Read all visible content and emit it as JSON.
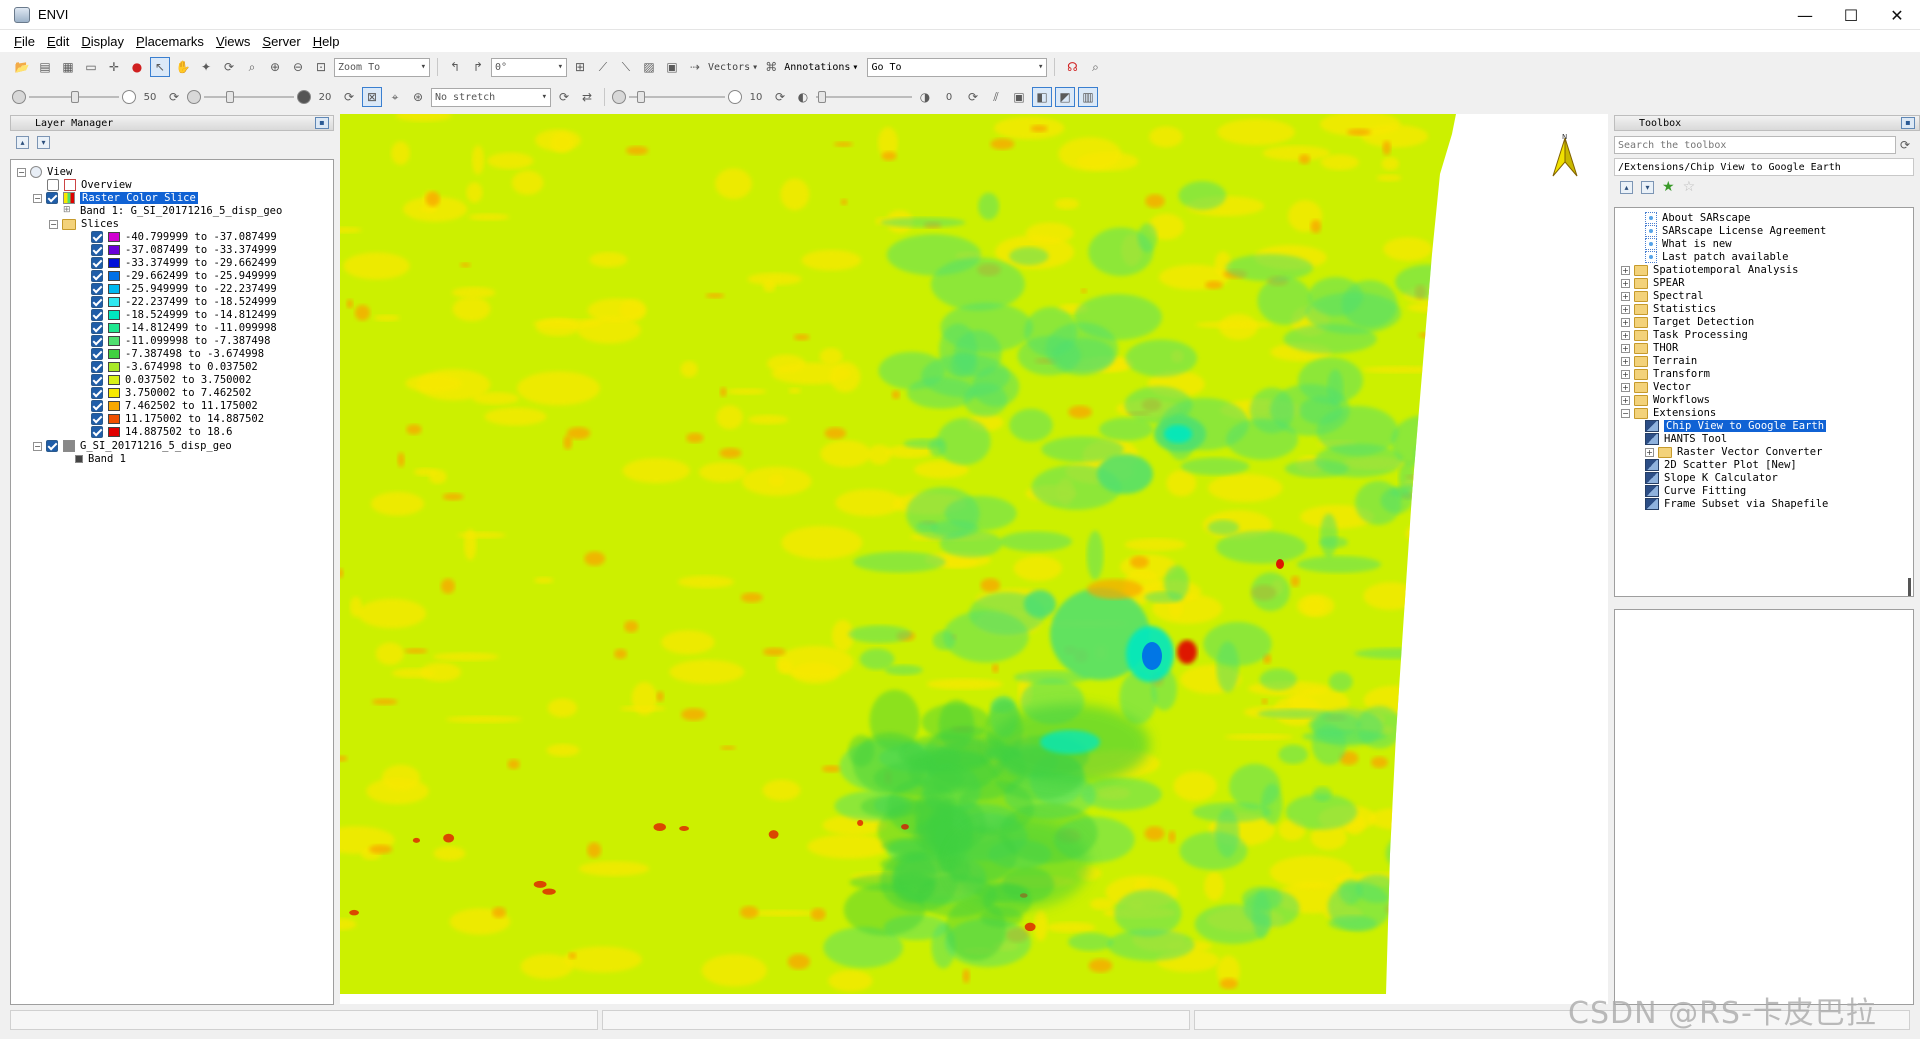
{
  "window": {
    "title": "ENVI",
    "controls": [
      "minimize-icon",
      "maximize-icon",
      "close-icon"
    ]
  },
  "menu": [
    "File",
    "Edit",
    "Display",
    "Placemarks",
    "Views",
    "Server",
    "Help"
  ],
  "toolbar": {
    "zoom_to_placeholder": "Zoom To",
    "rotation_value": "0°",
    "vectors_label": "Vectors",
    "annotations_label": "Annotations",
    "goto_value": "Go To",
    "brightness_value": "50",
    "contrast_value": "20",
    "stretch_value": "No stretch",
    "sharpen_value": "10",
    "transparency_value": "0"
  },
  "layer_manager": {
    "title": "Layer Manager",
    "view_label": "View",
    "overview_label": "Overview",
    "raster_color_slice_label": "Raster Color Slice",
    "band_label": "Band 1: G_SI_20171216_5_disp_geo",
    "slices_label": "Slices",
    "slices": [
      {
        "label": "-40.799999  to  -37.087499",
        "color": "#d000d0"
      },
      {
        "label": "-37.087499  to  -33.374999",
        "color": "#6a00d8"
      },
      {
        "label": "-33.374999  to  -29.662499",
        "color": "#0010d8"
      },
      {
        "label": "-29.662499  to  -25.949999",
        "color": "#0070e8"
      },
      {
        "label": "-25.949999  to  -22.237499",
        "color": "#00b8f0"
      },
      {
        "label": "-22.237499  to  -18.524999",
        "color": "#30e8f0"
      },
      {
        "label": "-18.524999  to  -14.812499",
        "color": "#00e8c0"
      },
      {
        "label": "-14.812499  to  -11.099998",
        "color": "#20e890"
      },
      {
        "label": "-11.099998  to  -7.387498",
        "color": "#50e070"
      },
      {
        "label": "-7.387498  to  -3.674998",
        "color": "#40d040"
      },
      {
        "label": "-3.674998  to  0.037502",
        "color": "#a8e828"
      },
      {
        "label": "0.037502  to  3.750002",
        "color": "#d8f018"
      },
      {
        "label": "3.750002  to  7.462502",
        "color": "#f8e800"
      },
      {
        "label": "7.462502  to  11.175002",
        "color": "#f8a800"
      },
      {
        "label": "11.175002  to  14.887502",
        "color": "#f05000"
      },
      {
        "label": "14.887502  to  18.6",
        "color": "#e00000"
      }
    ],
    "dataset_label": "G_SI_20171216_5_disp_geo",
    "dataset_band_label": "Band 1"
  },
  "toolbox": {
    "title": "Toolbox",
    "search_placeholder": "Search the toolbox",
    "path": "/Extensions/Chip View to Google Earth",
    "items": [
      {
        "label": "About SARscape",
        "kind": "doc",
        "indent": 2
      },
      {
        "label": "SARscape License Agreement",
        "kind": "doc",
        "indent": 2
      },
      {
        "label": "What is new",
        "kind": "doc",
        "indent": 2
      },
      {
        "label": "Last patch available",
        "kind": "doc",
        "indent": 2
      },
      {
        "label": "Spatiotemporal Analysis",
        "kind": "folder",
        "indent": 1
      },
      {
        "label": "SPEAR",
        "kind": "folder",
        "indent": 1
      },
      {
        "label": "Spectral",
        "kind": "folder",
        "indent": 1
      },
      {
        "label": "Statistics",
        "kind": "folder",
        "indent": 1
      },
      {
        "label": "Target Detection",
        "kind": "folder",
        "indent": 1
      },
      {
        "label": "Task Processing",
        "kind": "folder",
        "indent": 1
      },
      {
        "label": "THOR",
        "kind": "folder",
        "indent": 1
      },
      {
        "label": "Terrain",
        "kind": "folder",
        "indent": 1
      },
      {
        "label": "Transform",
        "kind": "folder",
        "indent": 1
      },
      {
        "label": "Vector",
        "kind": "folder",
        "indent": 1
      },
      {
        "label": "Workflows",
        "kind": "folder",
        "indent": 1
      },
      {
        "label": "Extensions",
        "kind": "folder-open",
        "indent": 1
      },
      {
        "label": "Chip View to Google Earth",
        "kind": "tool",
        "indent": 2,
        "selected": true
      },
      {
        "label": "HANTS Tool",
        "kind": "tool",
        "indent": 2
      },
      {
        "label": "Raster Vector Converter",
        "kind": "folder",
        "indent": 2
      },
      {
        "label": "2D Scatter Plot [New]",
        "kind": "tool",
        "indent": 2
      },
      {
        "label": "Slope K Calculator",
        "kind": "tool",
        "indent": 2
      },
      {
        "label": "Curve Fitting",
        "kind": "tool",
        "indent": 2
      },
      {
        "label": "Frame Subset via Shapefile",
        "kind": "tool",
        "indent": 2
      }
    ]
  },
  "map": {
    "north_label": "N",
    "base_color": "#ccf000",
    "colors": {
      "yellow": "#f8e800",
      "orange": "#f8a800",
      "red": "#e00000",
      "green": "#50e070",
      "dkgreen": "#40d040",
      "cyan": "#00e8c0",
      "blue": "#0070e8"
    }
  },
  "watermark": "CSDN @RS-卡皮巴拉"
}
